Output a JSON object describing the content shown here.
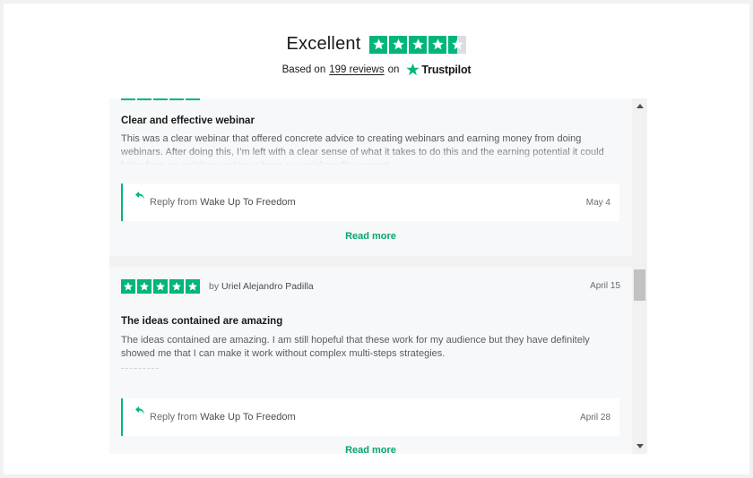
{
  "header": {
    "rating_word": "Excellent",
    "stars_filled": 4.5,
    "based_on": "Based on",
    "reviews_link": "199 reviews",
    "on": "on",
    "logo_text": "Trustpilot"
  },
  "colors": {
    "brand_green": "#00b67a",
    "empty_star": "#dcdce6",
    "link_green": "#04a56c"
  },
  "reviews": [
    {
      "title": "Clear and effective webinar",
      "body": "This was a clear webinar that offered concrete advice to creating webinars and earning money from doing webinars. After doing this, I’m left with a clear sense of what it takes to do this and the earning potential it could bring from an existing customer base or social media account.",
      "reply_prefix": "Reply from",
      "reply_name": "Wake Up To Freedom",
      "reply_date": "May 4",
      "read_more": "Read more"
    },
    {
      "rating": 5,
      "author_prefix": "by",
      "author_name": "Uriel Alejandro Padilla",
      "date": "April 15",
      "title": "The ideas contained are amazing",
      "body": "The ideas contained are amazing. I am still hopeful that these work for my audience but they have definitely showed me that I can make it work without complex multi-steps strategies.",
      "reply_prefix": "Reply from",
      "reply_name": "Wake Up To Freedom",
      "reply_date": "April 28",
      "read_more": "Read more"
    }
  ]
}
